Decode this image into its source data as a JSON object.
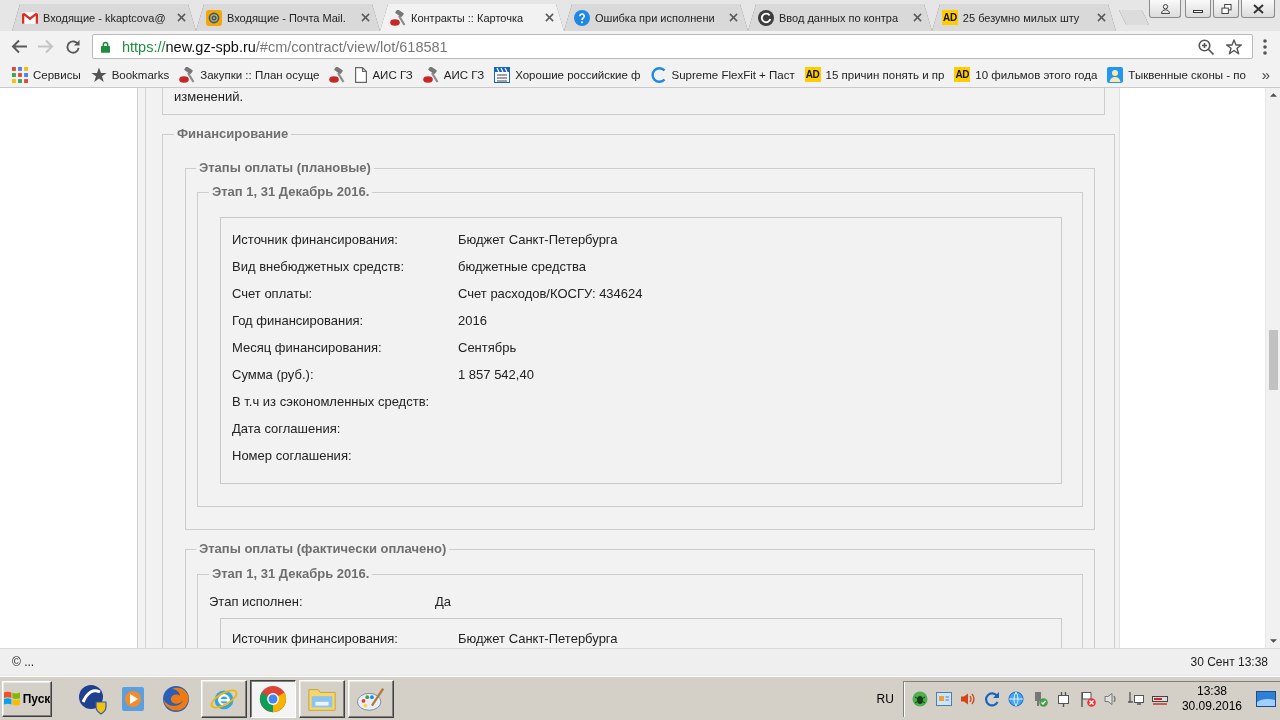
{
  "window": {
    "tabs": [
      {
        "title": "Входящие - kkaptcova@",
        "selected": false
      },
      {
        "title": "Входящие - Почта Mail.",
        "selected": false
      },
      {
        "title": "Контракты :: Карточка",
        "selected": true
      },
      {
        "title": "Ошибка при исполнени",
        "selected": false
      },
      {
        "title": "Ввод данных по контра",
        "selected": false
      },
      {
        "title": "25 безумно милых шту",
        "favicon_text": "AD",
        "selected": false
      }
    ]
  },
  "toolbar": {
    "back": {
      "disabled": false
    },
    "forward": {
      "disabled": true
    },
    "url": {
      "scheme": "https://",
      "host": "new.gz-spb.ru",
      "path": "/#cm/contract/view/lot/618581"
    }
  },
  "bookmarks": {
    "items": [
      {
        "kind": "link",
        "label": "Сервисы"
      },
      {
        "kind": "link",
        "label": "Bookmarks"
      },
      {
        "kind": "link",
        "label": "Закупки :: План осуще"
      },
      {
        "kind": "icon"
      },
      {
        "kind": "link",
        "label": "АИС ГЗ"
      },
      {
        "kind": "link",
        "label": "АИС ГЗ"
      },
      {
        "kind": "link",
        "label": "Хорошие российские ф"
      },
      {
        "kind": "link",
        "label": "Supreme FlexFit + Паст"
      },
      {
        "kind": "link",
        "favicon_text": "AD",
        "label": "15 причин понять и пр"
      },
      {
        "kind": "link",
        "favicon_text": "AD",
        "label": "10 фильмов этого года"
      },
      {
        "kind": "link",
        "label": "Тыквенные сконы - по"
      }
    ],
    "overflow": "»"
  },
  "page": {
    "previous_section_tail": "изменений.",
    "financing": {
      "legend": "Финансирование",
      "groups": [
        {
          "legend": "Этапы оплаты (плановые)",
          "stages": [
            {
              "legend": "Этап 1, 31 Декабрь 2016.",
              "fields": [
                {
                  "label": "Источник финансирования:",
                  "value": "Бюджет Санкт-Петербурга"
                },
                {
                  "label": "Вид внебюджетных средств:",
                  "value": "бюджетные средства"
                },
                {
                  "label": "Счет оплаты:",
                  "value": "Счет расходов/КОСГУ: 434624"
                },
                {
                  "label": "Год финансирования:",
                  "value": "2016"
                },
                {
                  "label": "Месяц финансирования:",
                  "value": "Сентябрь"
                },
                {
                  "label": "Сумма (руб.):",
                  "value": "1 857 542,40"
                },
                {
                  "label": "В т.ч из сэкономленных средств:"
                },
                {
                  "label": "Дата соглашения:"
                },
                {
                  "label": "Номер соглашения:"
                }
              ]
            }
          ]
        },
        {
          "legend": "Этапы оплаты (фактически оплачено)",
          "stages": [
            {
              "legend": "Этап 1, 31 Декабрь 2016.",
              "status": {
                "label": "Этап исполнен:",
                "value": "Да"
              },
              "fields": [
                {
                  "label": "Источник финансирования:",
                  "value": "Бюджет Санкт-Петербурга"
                }
              ]
            }
          ]
        }
      ]
    }
  },
  "status_bar": {
    "left": "© ...",
    "right": "30 Сент 13:38"
  },
  "taskbar": {
    "start": "Пуск",
    "windows": [
      {
        "selected": false
      },
      {
        "selected": true
      },
      {
        "selected": false
      },
      {
        "selected": false
      }
    ],
    "language": "RU",
    "clock": {
      "time": "13:38",
      "date": "30.09.2016"
    }
  }
}
